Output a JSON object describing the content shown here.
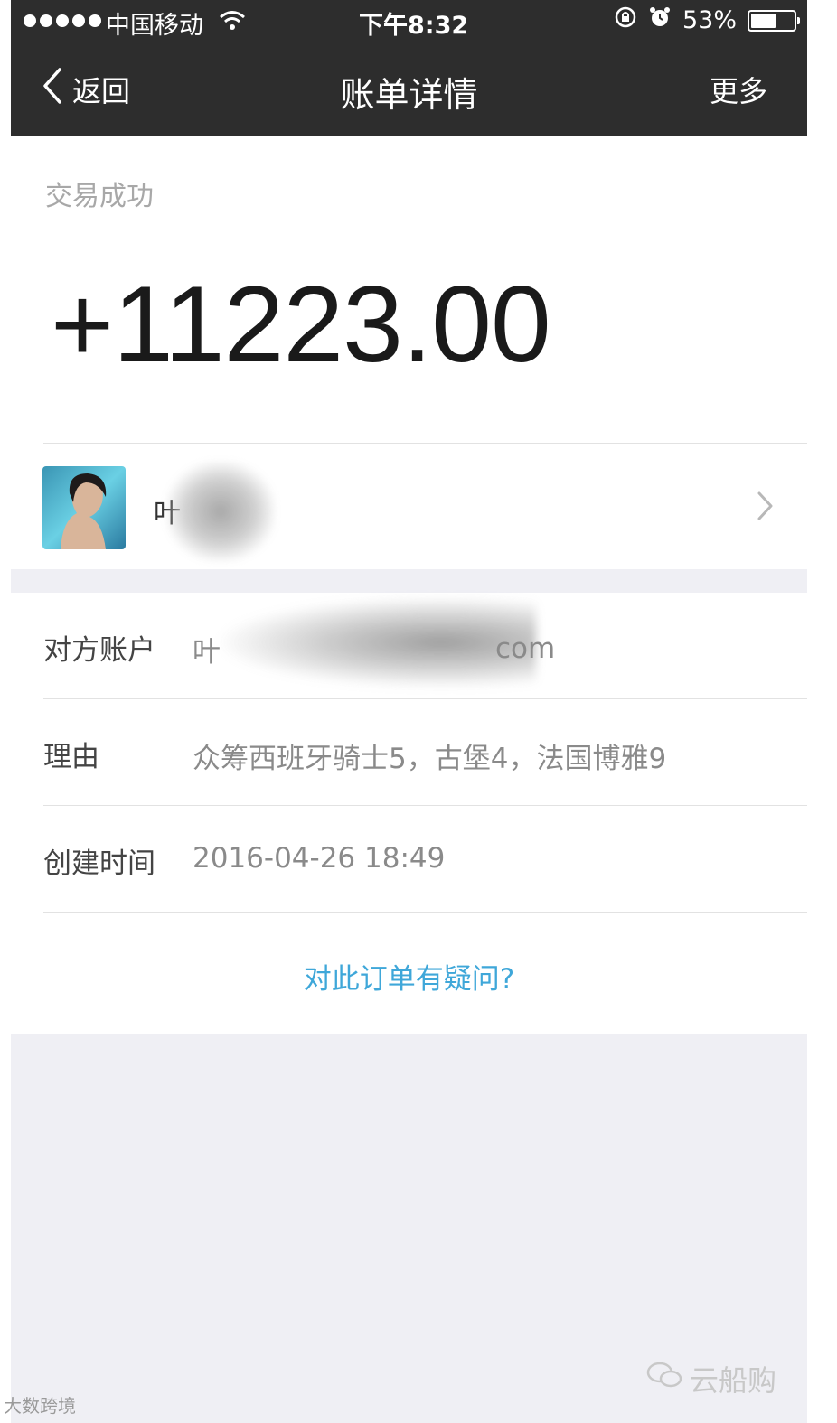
{
  "status_bar": {
    "carrier": "中国移动",
    "time": "下午8:32",
    "battery": "53%",
    "battery_level": 0.53
  },
  "nav": {
    "back_label": "返回",
    "title": "账单详情",
    "more_label": "更多"
  },
  "transaction": {
    "status": "交易成功",
    "amount": "+11223.00",
    "contact_name": "叶"
  },
  "details": {
    "account_label": "对方账户",
    "account_value": "叶",
    "account_suffix": "com",
    "reason_label": "理由",
    "reason_value": "众筹西班牙骑士5，古堡4，法国博雅9",
    "created_label": "创建时间",
    "created_value": "2016-04-26 18:49",
    "question_link": "对此订单有疑问?"
  },
  "watermarks": {
    "right": "云船购",
    "left": "大数跨境"
  },
  "colors": {
    "topbar": "#2d2d2d",
    "link": "#3fa7d9",
    "page_bg": "#efeff4"
  }
}
